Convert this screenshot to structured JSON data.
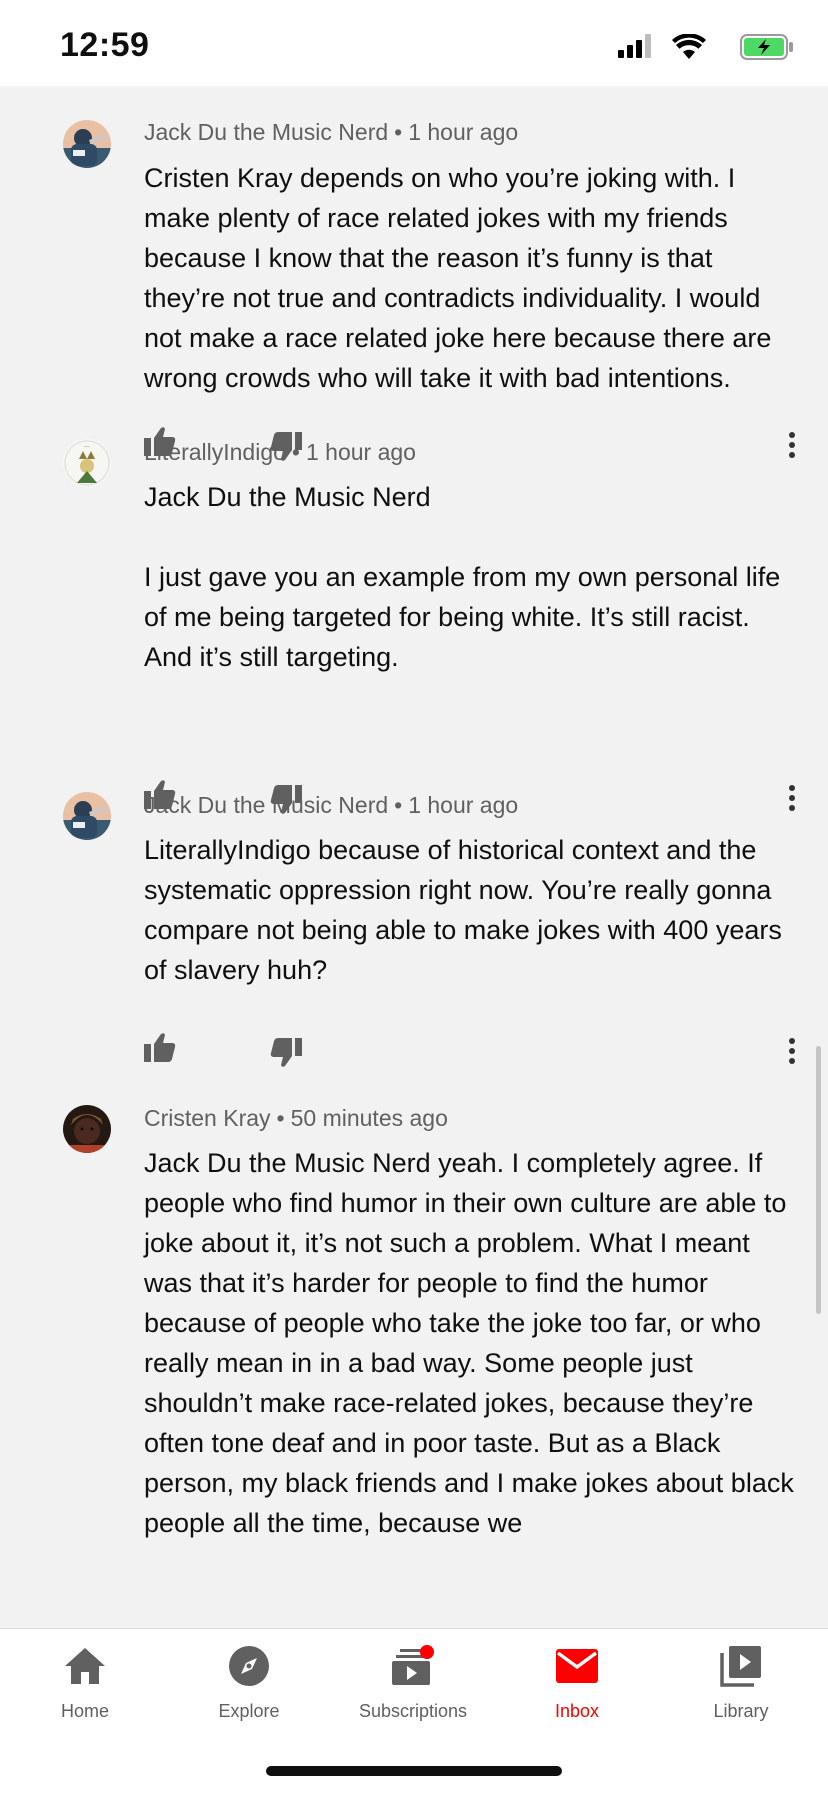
{
  "status_bar": {
    "time": "12:59"
  },
  "comments": [
    {
      "author": "Jack Du the Music Nerd",
      "time_ago": "1 hour ago",
      "text": "Cristen Kray depends on who you’re joking with. I make plenty of race related jokes with my friends because I know that the reason it’s funny is that they’re not true and contradicts individuality. I would not make a race related joke here because there are wrong crowds who will take it with bad intentions."
    },
    {
      "author": "LiterallyIndigo",
      "time_ago": "1 hour ago",
      "text": "Jack Du the Music Nerd\n\nI just gave you an example from my own personal life of me being targeted for being white. It’s still racist. And it’s still targeting."
    },
    {
      "author": "Jack Du the Music Nerd",
      "time_ago": "1 hour ago",
      "text": "LiterallyIndigo because of historical context and the systematic oppression right now. You’re really gonna compare not being able to make jokes with 400 years of slavery huh?"
    },
    {
      "author": "Cristen Kray",
      "time_ago": "50 minutes ago",
      "text": "Jack Du the Music Nerd yeah. I completely agree. If people who find humor in their own culture are able to joke about it, it’s not such a problem. What I meant was that it’s harder for people to find the humor because of people who take the joke too far, or who really mean in in a bad way. Some people just shouldn’t make race-related jokes, because they’re often tone deaf and in poor taste. But as a Black person, my black friends and I make jokes about black people all the time, because we"
    }
  ],
  "bottom_nav": {
    "items": [
      {
        "label": "Home",
        "icon": "home-icon"
      },
      {
        "label": "Explore",
        "icon": "compass-icon"
      },
      {
        "label": "Subscriptions",
        "icon": "subscriptions-icon"
      },
      {
        "label": "Inbox",
        "icon": "mail-icon"
      },
      {
        "label": "Library",
        "icon": "library-icon"
      }
    ],
    "active": "Inbox"
  },
  "colors": {
    "accent": "#ff0000",
    "background": "#f2f2f2",
    "secondary_text": "#606060",
    "battery": "#4cd964"
  }
}
